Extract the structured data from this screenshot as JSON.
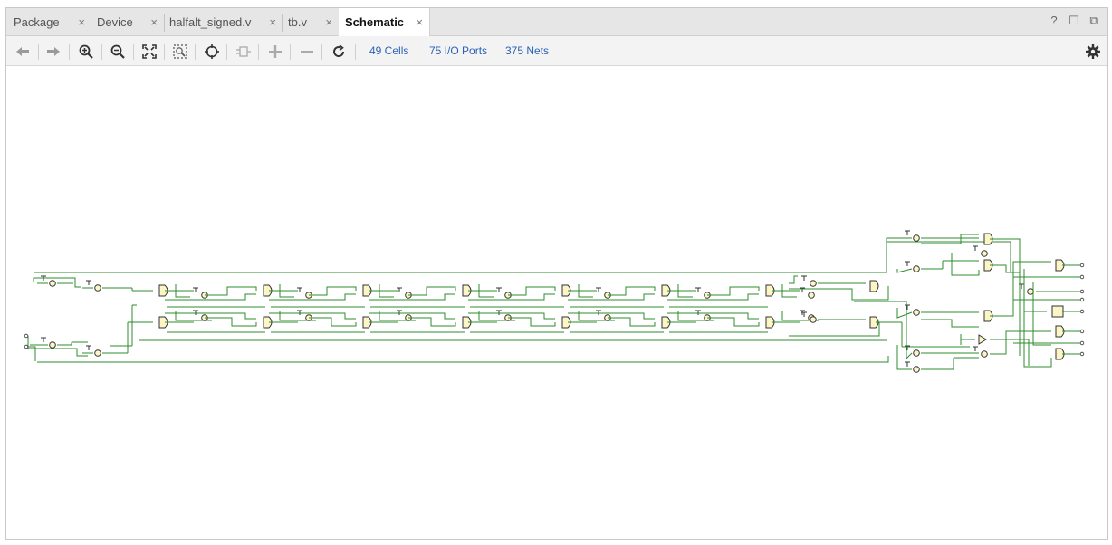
{
  "tabs": [
    {
      "label": "Package",
      "active": false
    },
    {
      "label": "Device",
      "active": false
    },
    {
      "label": "halfalt_signed.v",
      "active": false
    },
    {
      "label": "tb.v",
      "active": false
    },
    {
      "label": "Schematic",
      "active": true
    }
  ],
  "close_glyph": "×",
  "window_controls": {
    "help": "?",
    "maximize": "☐",
    "float": "⧉"
  },
  "toolbar": {
    "icons": [
      "back-icon",
      "forward-icon",
      "zoom-in-icon",
      "zoom-out-icon",
      "fit-icon",
      "zoom-area-icon",
      "find-icon",
      "regenerate-icon",
      "expand-icon",
      "collapse-icon",
      "refresh-icon"
    ],
    "cells": "49 Cells",
    "io_ports": "75 I/O Ports",
    "nets": "375 Nets",
    "settings_icon": "gear-icon"
  },
  "colors": {
    "wire": "#2e8b2e",
    "gate_fill": "#fcf6c6",
    "gate_stroke": "#333333",
    "link": "#2a62b8"
  }
}
